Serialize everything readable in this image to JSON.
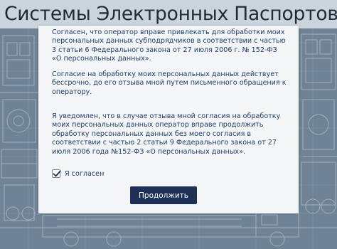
{
  "header": {
    "title": "Системы Электронных Паспортов"
  },
  "consent_dialog": {
    "paragraphs": [
      "Согласен, что оператор вправе привлекать для обработки моих персональных данных субподрядчиков в соответствии с частью 3 статьи 6 Федерального закона от 27 июля 2006 г. № 152-ФЗ «О персональных данных».",
      "Согласие на обработку моих персональных данных действует бессрочно, до его отзыва мной путем письменного обращения к оператору.",
      "Я уведомлен, что в случае отзыва мной согласия на обработку моих персональных данных оператор вправе продолжить обработку персональных данных без моего согласия в соответствии с частью 2 статьи 9 Федерального закона от 27 июля 2006 года №152-ФЗ «О персональных данных»."
    ],
    "checkbox": {
      "label": "Я согласен",
      "checked": true
    },
    "continue_button": {
      "label": "Продолжить"
    }
  },
  "colors": {
    "accent": "#1c3155",
    "text": "#1d3e68",
    "background": "#6f8395"
  }
}
